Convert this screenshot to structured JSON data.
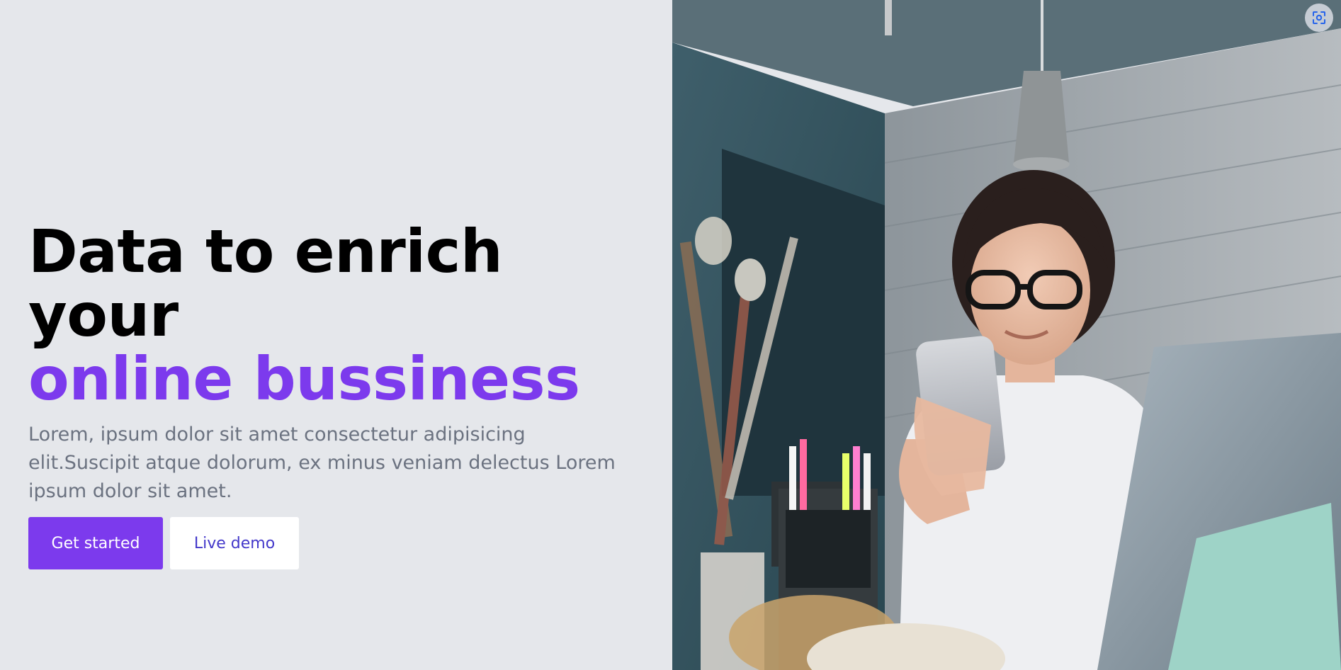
{
  "hero": {
    "headline_line1": "Data to enrich your",
    "headline_line2": "online bussiness",
    "description": "Lorem, ipsum dolor sit amet consectetur adipisicing elit.Suscipit atque dolorum, ex minus veniam delectus Lorem ipsum dolor sit amet.",
    "primary_button": "Get started",
    "secondary_button": "Live demo"
  },
  "image": {
    "icon": "visual-search-icon"
  },
  "colors": {
    "accent": "#7c3aed",
    "background": "#e5e7eb",
    "secondary_text": "#4338ca",
    "muted_text": "#6b7280"
  }
}
